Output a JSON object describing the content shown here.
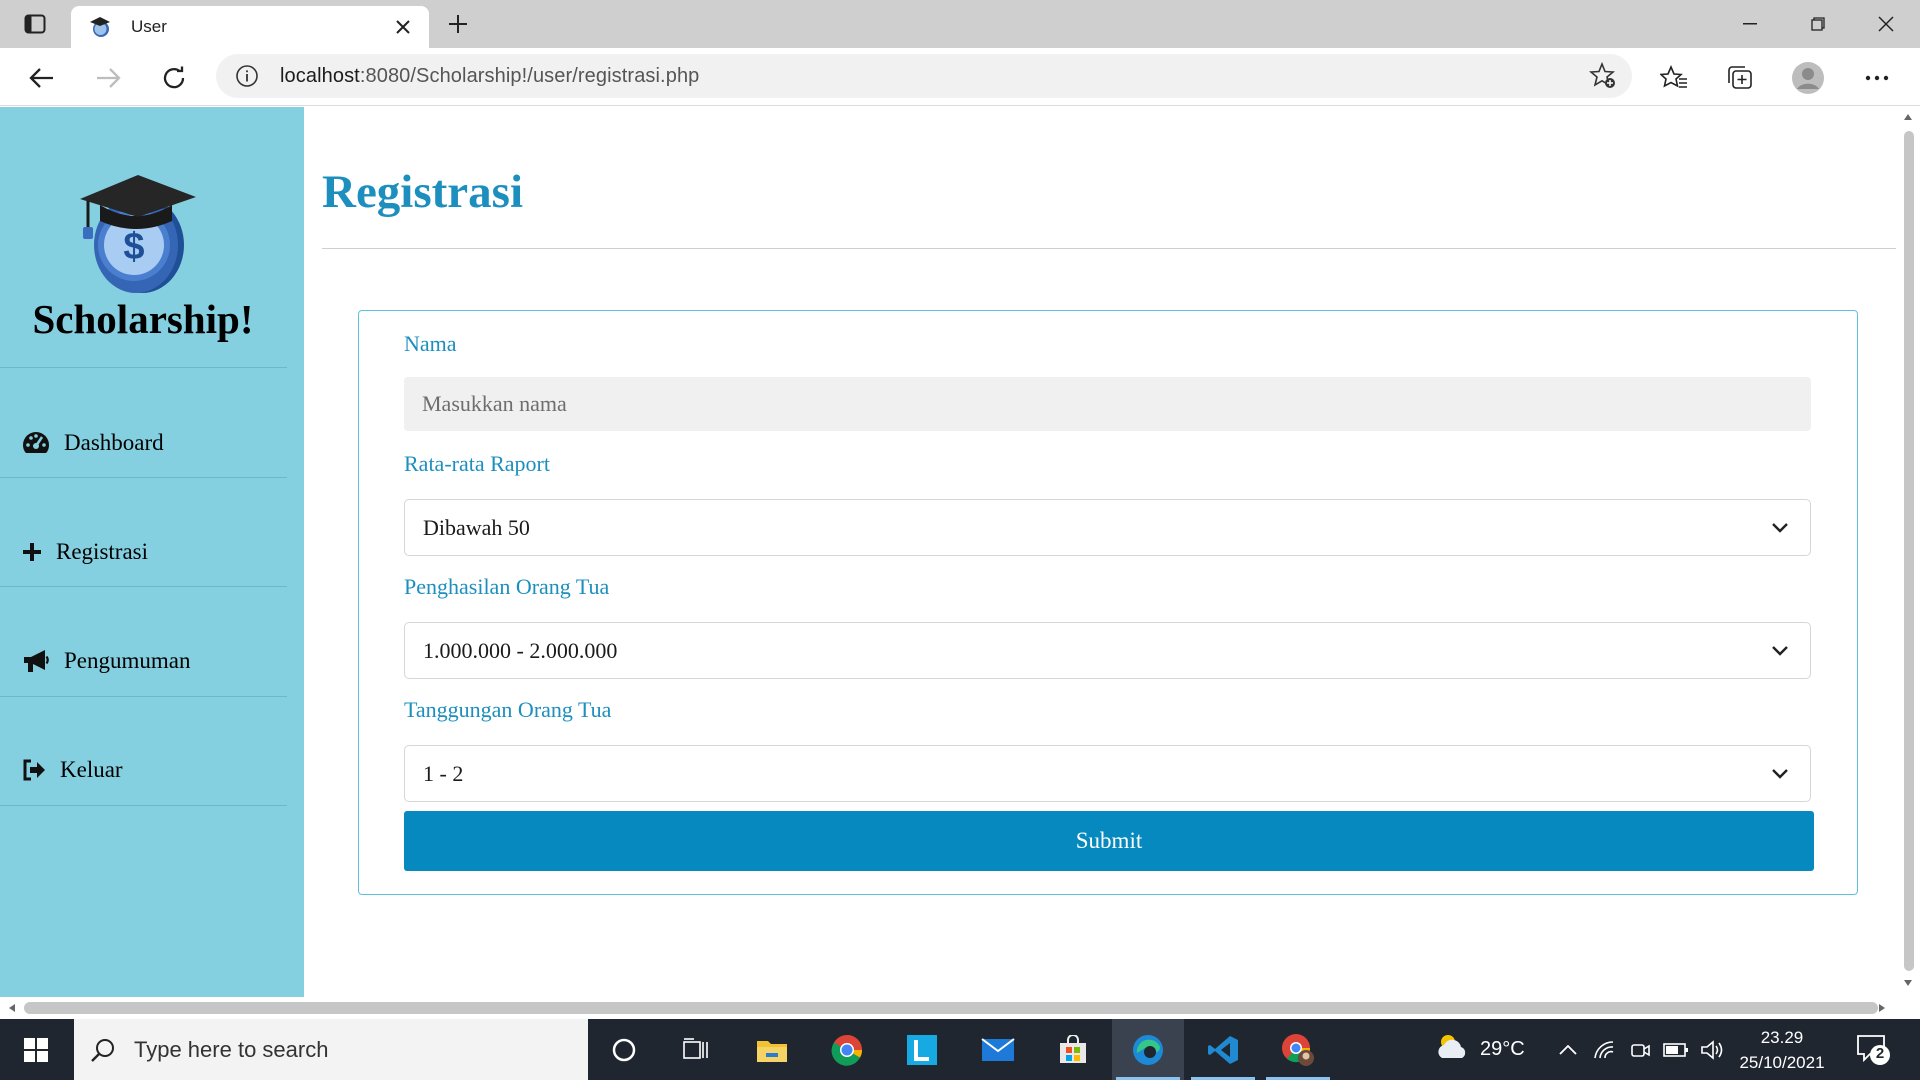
{
  "browser": {
    "tab_title": "User",
    "url_host": "localhost",
    "url_path": ":8080/Scholarship!/user/registrasi.php"
  },
  "sidebar": {
    "brand": "Scholarship!",
    "items": [
      {
        "label": "Dashboard",
        "icon": "tachometer-icon"
      },
      {
        "label": "Registrasi",
        "icon": "plus-icon"
      },
      {
        "label": "Pengumuman",
        "icon": "bullhorn-icon"
      },
      {
        "label": "Keluar",
        "icon": "sign-out-icon"
      }
    ]
  },
  "main": {
    "title": "Registrasi",
    "form": {
      "nama_label": "Nama",
      "nama_placeholder": "Masukkan nama",
      "raport_label": "Rata-rata Raport",
      "raport_value": "Dibawah 50",
      "penghasilan_label": "Penghasilan Orang Tua",
      "penghasilan_value": "1.000.000 - 2.000.000",
      "tanggungan_label": "Tanggungan Orang Tua",
      "tanggungan_value": "1 - 2",
      "submit_label": "Submit"
    }
  },
  "logo_symbol": "$",
  "taskbar": {
    "search_placeholder": "Type here to search",
    "weather_temp": "29°C",
    "time": "23.29",
    "date": "25/10/2021",
    "notification_count": "2"
  },
  "colors": {
    "sidebar_bg": "#85d0e0",
    "accent": "#1c8fbe",
    "button": "#0589be"
  }
}
